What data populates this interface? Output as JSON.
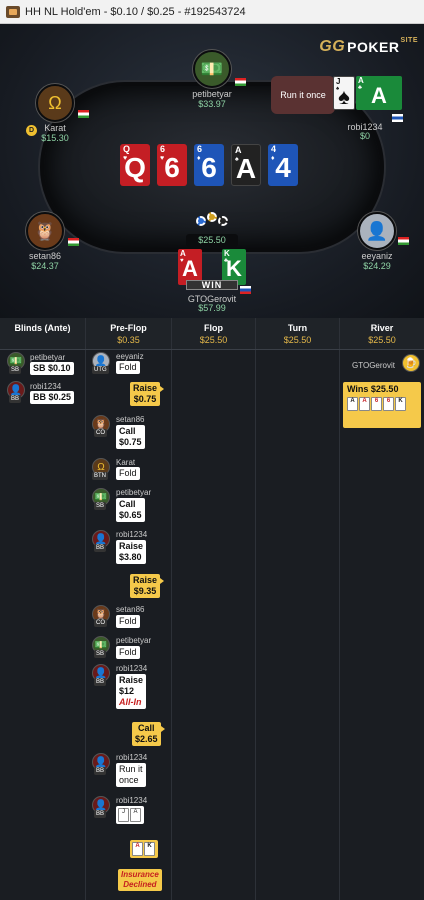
{
  "window": {
    "title": "HH NL Hold'em - $0.10 / $0.25 - #192543724"
  },
  "logo": {
    "gg": "GG",
    "poker": "POKER",
    "site": "SITE"
  },
  "bubble": "Run it once",
  "board": [
    "Q",
    "6",
    "6",
    "A",
    "4"
  ],
  "pot": "$25.50",
  "win_badge": "WIN",
  "players": {
    "petibetyar": {
      "name": "petibetyar",
      "stack": "$33.97"
    },
    "karat": {
      "name": "Karat",
      "stack": "$15.30",
      "dealer": "D"
    },
    "robi1234": {
      "name": "robi1234",
      "stack": "$0",
      "cards": [
        "J",
        "A"
      ]
    },
    "setan86": {
      "name": "setan86",
      "stack": "$24.37"
    },
    "eeyaniz": {
      "name": "eeyaniz",
      "stack": "$24.29"
    },
    "gtogerovit": {
      "name": "GTOGerovit",
      "stack": "$57.99",
      "cards": [
        "A",
        "K"
      ]
    }
  },
  "history": {
    "columns": [
      {
        "title": "Blinds (Ante)",
        "amount": ""
      },
      {
        "title": "Pre-Flop",
        "amount": "$0.35"
      },
      {
        "title": "Flop",
        "amount": "$25.50"
      },
      {
        "title": "Turn",
        "amount": "$25.50"
      },
      {
        "title": "River",
        "amount": "$25.50"
      }
    ],
    "blinds": [
      {
        "player": "petibetyar",
        "pos": "SB",
        "label": "SB $0.10"
      },
      {
        "player": "robi1234",
        "pos": "BB",
        "label": "BB $0.25"
      }
    ],
    "preflop": [
      {
        "player": "eeyaniz",
        "pos": "UTG",
        "action": "Fold"
      },
      {
        "hero_action": "Raise",
        "hero_amount": "$0.75"
      },
      {
        "player": "setan86",
        "pos": "CO",
        "action": "Call",
        "amount": "$0.75"
      },
      {
        "player": "Karat",
        "pos": "BTN",
        "action": "Fold"
      },
      {
        "player": "petibetyar",
        "pos": "SB",
        "action": "Call",
        "amount": "$0.65"
      },
      {
        "player": "robi1234",
        "pos": "BB",
        "action": "Raise",
        "amount": "$3.80"
      },
      {
        "hero_action": "Raise",
        "hero_amount": "$9.35"
      },
      {
        "player": "setan86",
        "pos": "CO",
        "action": "Fold"
      },
      {
        "player": "petibetyar",
        "pos": "SB",
        "action": "Fold"
      },
      {
        "player": "robi1234",
        "pos": "BB",
        "action": "Raise",
        "amount": "$12",
        "allin": "All-In"
      },
      {
        "hero_action": "Call",
        "hero_amount": "$2.65"
      },
      {
        "player": "robi1234",
        "pos": "BB",
        "action_lines": [
          "Run it",
          "once"
        ]
      },
      {
        "player": "robi1234",
        "pos": "BB",
        "cards": [
          "J",
          "A"
        ]
      },
      {
        "hero_cards": [
          "A",
          "K"
        ]
      },
      {
        "insurance": [
          "Insurance",
          "Declined"
        ]
      }
    ],
    "river": {
      "player": "GTOGerovit",
      "wins_label": "Wins $25.50",
      "cards": [
        "A",
        "A",
        "6",
        "6",
        "K"
      ]
    }
  }
}
